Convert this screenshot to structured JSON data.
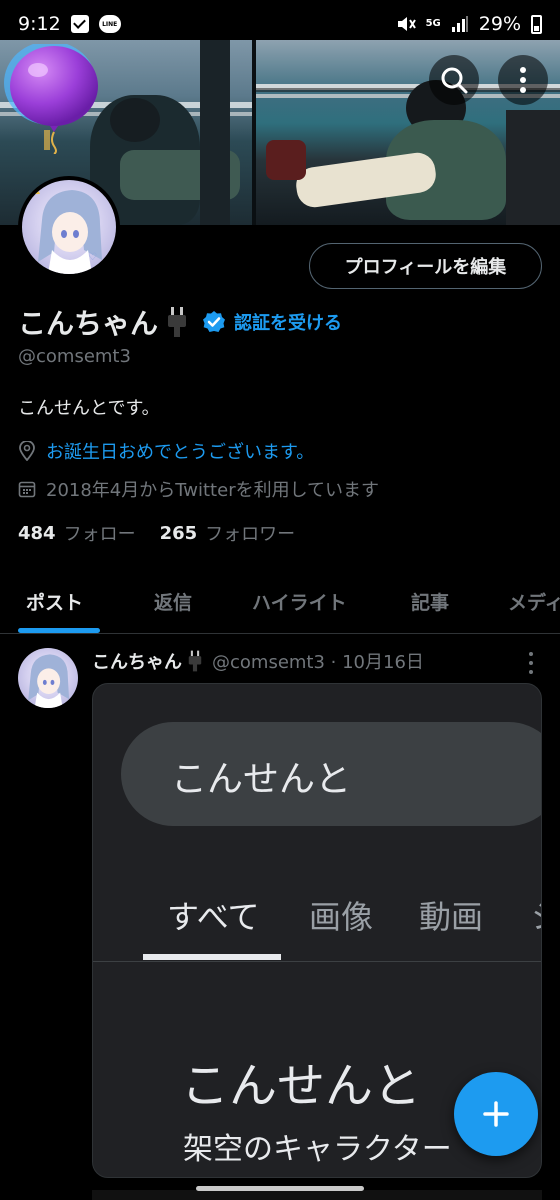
{
  "status_bar": {
    "time": "9:12",
    "line_label": "LINE",
    "network": "5G",
    "battery": "29%"
  },
  "profile": {
    "edit_button_label": "プロフィールを編集",
    "display_name": "こんちゃん",
    "verify_label": "認証を受ける",
    "handle": "@comsemt3",
    "bio": "こんせんとです。",
    "location": "お誕生日おめでとうございます。",
    "joined": "2018年4月からTwitterを利用しています",
    "following_count": "484",
    "following_label": "フォロー",
    "followers_count": "265",
    "followers_label": "フォロワー"
  },
  "tabs": [
    {
      "label": "ポスト"
    },
    {
      "label": "返信"
    },
    {
      "label": "ハイライト"
    },
    {
      "label": "記事"
    },
    {
      "label": "メディア"
    }
  ],
  "post": {
    "author": "こんちゃん",
    "meta": "@comsemt3 · 10月16日",
    "media": {
      "search_text": "こんせんと",
      "tabs": [
        "すべて",
        "画像",
        "動画",
        "ショ"
      ],
      "title": "こんせんと",
      "subtitle": "架空のキャラクター"
    }
  },
  "colors": {
    "accent": "#1d9bf0",
    "background": "#000000",
    "secondary_text": "#71767b"
  },
  "icons": {
    "header": [
      "search-icon",
      "more-vertical-icon"
    ],
    "meta": [
      "location-pin-icon",
      "calendar-icon"
    ],
    "fab": "plus-icon"
  }
}
